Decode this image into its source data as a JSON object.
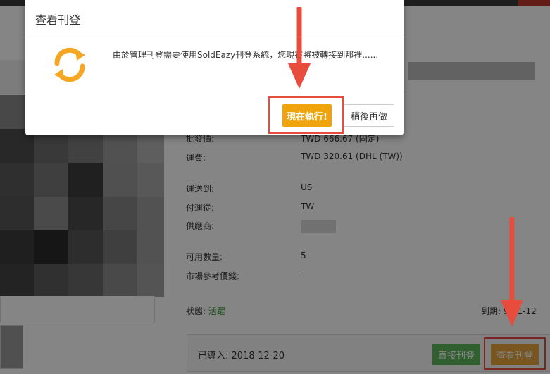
{
  "modal": {
    "title": "查看刊登",
    "message": "由於管理刊登需要使用SoldEazy刊登系統，您現在將被轉接到那裡......",
    "confirm_label": "現在執行!",
    "later_label": "稍後再做"
  },
  "listing": {
    "price_label": "批發價:",
    "price_value": "TWD 666.67 (固定)",
    "shipping_label": "運費:",
    "shipping_value": "TWD 320.61 (DHL (TW))",
    "ship_to_label": "運送到:",
    "ship_to_value": "US",
    "ship_from_label": "付運從:",
    "ship_from_value": "TW",
    "supplier_label": "供應商:",
    "available_label": "可用數量:",
    "available_value": "5",
    "market_price_label": "市場參考價錢:",
    "market_price_value": "-",
    "status_label": "狀態:",
    "status_value": "活躍",
    "expiry_label": "到期:",
    "expiry_value": "9-01-12",
    "imported_label": "已導入: 2018-12-20",
    "direct_listing_label": "直接刊登",
    "view_listing_label": "查看刊登"
  },
  "colors": {
    "accent_orange": "#f0a30a",
    "active_green": "#3c9d3c",
    "annotation_red": "#e74c3c"
  }
}
